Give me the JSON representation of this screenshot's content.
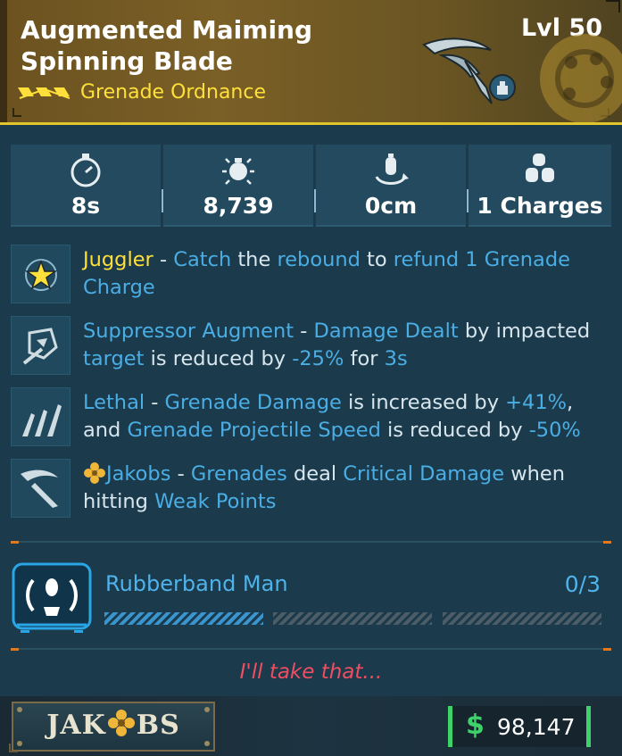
{
  "item": {
    "title": "Augmented Maiming Spinning Blade",
    "level": "Lvl 50",
    "type": "Grenade Ordnance",
    "rarity_color": "#ffe03a",
    "accent_color": "#e2c52c"
  },
  "stats": [
    {
      "icon": "stopwatch-icon",
      "value": "8s"
    },
    {
      "icon": "grenade-damage-icon",
      "value": "8,739"
    },
    {
      "icon": "grenade-radius-icon",
      "value": "0cm"
    },
    {
      "icon": "grenade-charges-icon",
      "value": "1 Charges"
    }
  ],
  "perks": [
    {
      "icon": "juggler-star-icon",
      "parts": [
        "Juggler",
        " - ",
        "Catch",
        " the ",
        "rebound",
        " to ",
        "refund 1 Grenade Charge"
      ]
    },
    {
      "icon": "suppressor-augment-icon",
      "parts": [
        "Suppressor Augment",
        " - ",
        "Damage Dealt",
        " by impacted ",
        "target",
        " is reduced by ",
        "-25%",
        " for ",
        "3s"
      ]
    },
    {
      "icon": "lethal-blades-icon",
      "parts": [
        "Lethal",
        " - ",
        "Grenade Damage",
        " is increased by ",
        "+41%",
        ",",
        "and ",
        "Grenade Projectile Speed",
        " is reduced by ",
        "-50%"
      ]
    },
    {
      "icon": "jakobs-blade-icon",
      "parts": [
        "Jakobs",
        " - ",
        "Grenades",
        " deal ",
        "Critical Damage",
        " when",
        "hitting ",
        "Weak Points"
      ]
    }
  ],
  "skill": {
    "name": "Rubberband Man",
    "rank": "0/3",
    "ranks_filled": 1,
    "ranks_total": 3,
    "icon": "rubberband-man-icon"
  },
  "flavor_text": "I'll take that...",
  "manufacturer": {
    "name_left": "JAK",
    "name_right": "BS",
    "logo_icon": "jakobs-clover-icon"
  },
  "price": {
    "symbol": "$",
    "value": "98,147",
    "color": "#3ed36a"
  },
  "colors": {
    "blue_text": "#4aaee5",
    "yellow_text": "#ffe03a",
    "flavor": "#ef4e62",
    "panel_bg": "#1b3a4b"
  }
}
